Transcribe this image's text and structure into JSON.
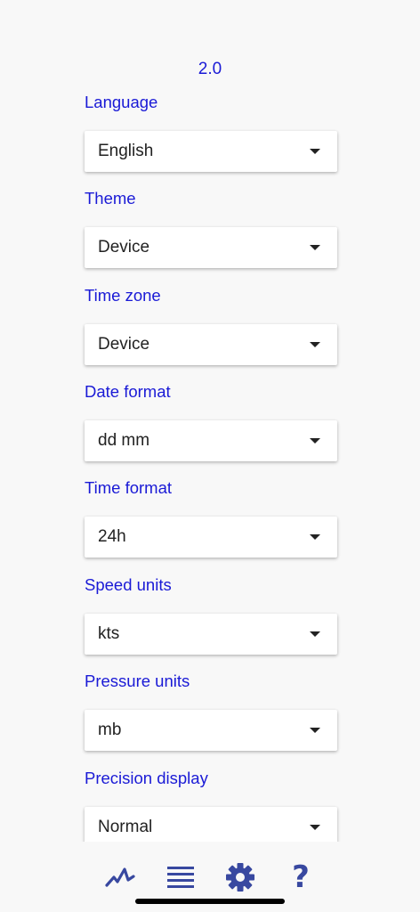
{
  "version": "2.0",
  "settings": [
    {
      "label": "Language",
      "value": "English"
    },
    {
      "label": "Theme",
      "value": "Device"
    },
    {
      "label": "Time zone",
      "value": "Device"
    },
    {
      "label": "Date format",
      "value": "dd mm"
    },
    {
      "label": "Time format",
      "value": "24h"
    },
    {
      "label": "Speed units",
      "value": "kts"
    },
    {
      "label": "Pressure units",
      "value": "mb"
    },
    {
      "label": "Precision display",
      "value": "Normal"
    }
  ],
  "nav": {
    "help_glyph": "?",
    "icons": [
      "chart-line-icon",
      "list-icon",
      "gear-icon",
      "help-icon"
    ]
  },
  "colors": {
    "accent": "#1a1ad6",
    "nav_icon": "#3848a0",
    "background": "#f8f8f8"
  }
}
